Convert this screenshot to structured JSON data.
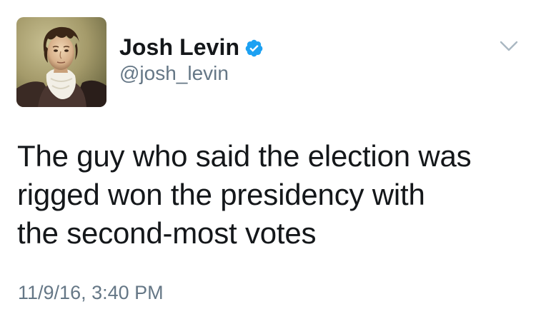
{
  "user": {
    "display_name": "Josh Levin",
    "handle": "@josh_levin",
    "verified": true,
    "avatar_icon": "portrait-avatar"
  },
  "tweet": {
    "text": "The guy who said the election was\nrigged won the presidency with\nthe second-most votes",
    "timestamp": "11/9/16, 3:40 PM"
  },
  "icons": {
    "verified": "verified-badge-icon",
    "menu": "chevron-down-icon"
  },
  "colors": {
    "verified_blue": "#1da1f2",
    "text": "#14171a",
    "secondary": "#657786",
    "caret": "#aab8c2"
  }
}
